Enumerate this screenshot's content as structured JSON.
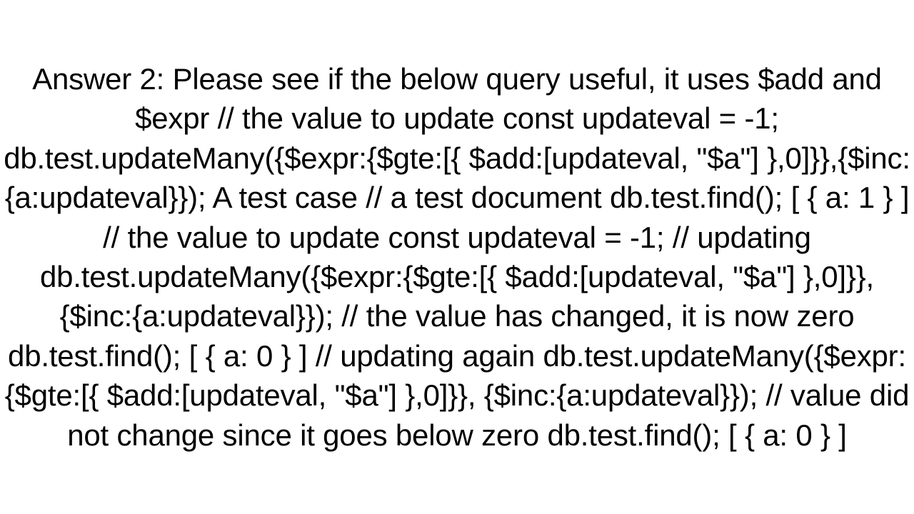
{
  "answer": {
    "label": "Answer 2:",
    "text": "Answer 2: Please see if the below query useful, it uses $add and $expr // the value to update const updateval = -1;  db.test.updateMany({$expr:{$gte:[{ $add:[updateval, \"$a\"] },0]}},{$inc:{a:updateval}});  A test case // a test document db.test.find(); [ { a: 1 } ]      // the value to update const updateval = -1;   // updating  db.test.updateMany({$expr:{$gte:[{ $add:[updateval, \"$a\"] },0]}},  {$inc:{a:updateval}});      // the value has changed, it is now zero db.test.find(); [ { a: 0 } ]      // updating again  db.test.updateMany({$expr:{$gte:[{ $add:[updateval, \"$a\"] },0]}},  {$inc:{a:updateval}});  // value did not change since it goes below zero db.test.find(); [ { a: 0 } ]"
  }
}
